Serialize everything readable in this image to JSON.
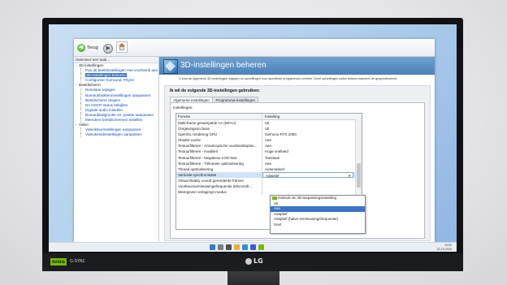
{
  "toolbar": {
    "back_label": "Terug"
  },
  "sidebar": {
    "header": "Selecteer een taak...",
    "items": [
      {
        "label": "3D-instellingen",
        "type": "category"
      },
      {
        "label": "Pas de beeldinstellingen met voorbeeld aan",
        "type": "child"
      },
      {
        "label": "3D-instellingen beheren",
        "type": "child",
        "selected": true
      },
      {
        "label": "Configureer Surround, PhysX",
        "type": "child"
      },
      {
        "label": "Beeldscherm",
        "type": "category"
      },
      {
        "label": "Resolutie wijzigen",
        "type": "child"
      },
      {
        "label": "Bureaubladkleurinstellingen aanpassen",
        "type": "child"
      },
      {
        "label": "Beeldscherm draaien",
        "type": "child"
      },
      {
        "label": "De HDCP-status bekijken",
        "type": "child"
      },
      {
        "label": "Digitale audio instellen",
        "type": "child"
      },
      {
        "label": "Bureaubladgrootte en -positie aanpassen",
        "type": "child"
      },
      {
        "label": "Meerdere beeldschermen instellen",
        "type": "child"
      },
      {
        "label": "Video",
        "type": "category"
      },
      {
        "label": "Videokleurinstellingen aanpassen",
        "type": "child"
      },
      {
        "label": "Videobeeldinstellingen aanpassen",
        "type": "child"
      }
    ]
  },
  "main": {
    "title": "3D-instellingen beheren",
    "description": "U kunt de algemene 3D-instellingen wijzigen en opheffingen voor specifieke programma's creëren. Deze opheffingen zullen telkens wanneer de gespecificeerde",
    "panel_title": "Ik wil de volgende 3D-instellingen gebruiken:",
    "tabs": [
      {
        "label": "Algemene instellingen",
        "active": true
      },
      {
        "label": "Programma-instellingen",
        "active": false
      }
    ],
    "settings_label": "Instellingen:",
    "grid": {
      "headers": [
        "Functie",
        "Instelling"
      ],
      "rows": [
        {
          "feature": "Multi-frame gesampelde AA (MFAA)",
          "value": "Uit"
        },
        {
          "feature": "Omgevingsocclusie",
          "value": "Uit"
        },
        {
          "feature": "OpenGL rendering GPU",
          "value": "GeForce RTX 2060"
        },
        {
          "feature": "Shader-cache",
          "value": "Aan"
        },
        {
          "feature": "Textuurfilteren - Anisotropische voorbeeldoptim...",
          "value": "Aan"
        },
        {
          "feature": "Textuurfilteren - Kwaliteit",
          "value": "Hoge snelheid"
        },
        {
          "feature": "Textuurfilteren - Negatieve LOD-bias",
          "value": "Toestaan"
        },
        {
          "feature": "Textuurfilteren - Trilineaire optimalisering",
          "value": "Aan"
        },
        {
          "feature": "Thread optimalisering",
          "value": "Automatisch"
        },
        {
          "feature": "Verticale synchronisatie",
          "value": "Adaptief",
          "selected": true
        },
        {
          "feature": "Virtual Reality vooraf gerenderde frames",
          "value": ""
        },
        {
          "feature": "Voorkeursvernieuwingsfrequentie (Microsoft...",
          "value": ""
        },
        {
          "feature": "Weergeven verlagings-modus",
          "value": ""
        }
      ]
    }
  },
  "dropdown": {
    "options": [
      {
        "label": "Gebruik de 3D-toepassingsinstelling",
        "icon": true
      },
      {
        "label": "Uit"
      },
      {
        "label": "Aan",
        "highlight": true
      },
      {
        "label": "Adaptief"
      },
      {
        "label": "Adaptief (halve vernieuwingsfrequentie)"
      },
      {
        "label": "Snel"
      }
    ]
  },
  "monitor": {
    "brand": "LG",
    "badge": "NVIDIA",
    "badge_text": "G-SYNC"
  },
  "taskbar": {
    "time": "13:51",
    "date": "22-10-2020"
  },
  "colors": {
    "accent": "#3a73c9",
    "banner": "#5a8fc4",
    "nvidia_green": "#76b900"
  }
}
